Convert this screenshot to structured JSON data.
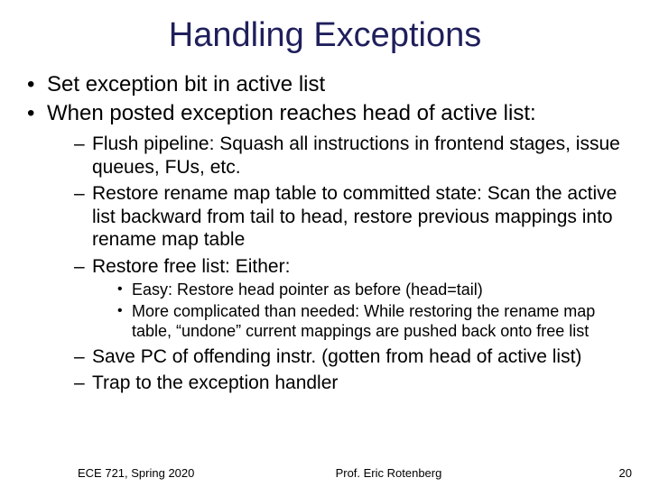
{
  "title": "Handling Exceptions",
  "bullets": {
    "b1": "Set exception bit in active list",
    "b2": "When posted exception reaches head of active list:",
    "sub1": "Flush pipeline: Squash all instructions in frontend stages, issue queues, FUs, etc.",
    "sub2": "Restore rename map table to committed state: Scan the active list backward from tail to head, restore previous mappings into rename map table",
    "sub3": "Restore free list: Either:",
    "subsub1": "Easy: Restore head pointer as before (head=tail)",
    "subsub2": "More complicated than needed: While restoring the rename map table, “undone” current mappings are pushed back onto free list",
    "sub4": "Save PC of offending instr. (gotten from head of active list)",
    "sub5": "Trap to the exception handler"
  },
  "footer": {
    "course": "ECE 721, Spring 2020",
    "author": "Prof. Eric Rotenberg",
    "page": "20"
  }
}
